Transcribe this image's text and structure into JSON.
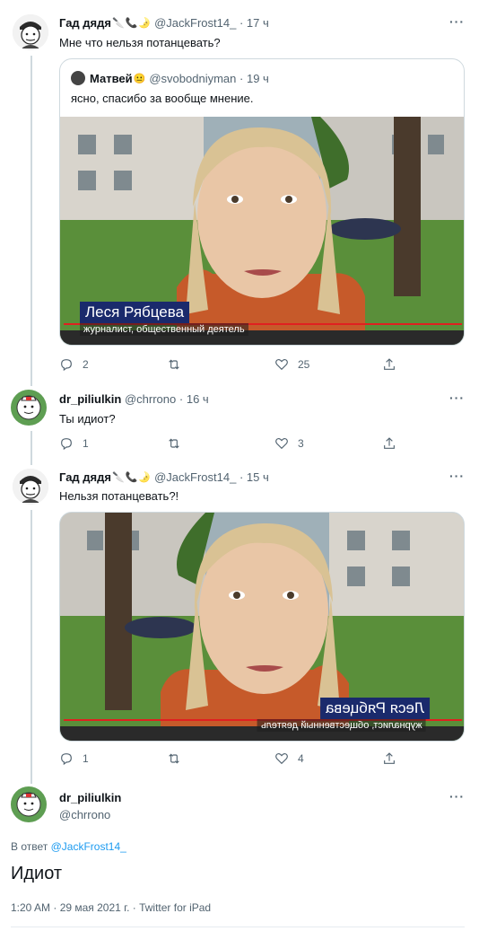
{
  "tweets": [
    {
      "name": "Гад дядя",
      "handle": "@JackFrost14_",
      "dot": "·",
      "time": "17 ч",
      "text": "Мне что нельзя потанцевать?",
      "quote": {
        "name": "Матвей",
        "handle": "@svobodniyman",
        "dot": "·",
        "time": "19 ч",
        "text": "ясно, спасибо за вообще мнение.",
        "video_caption": "Леся Рябцева",
        "video_sub": "журналист, общественный деятель"
      },
      "replies": "2",
      "retweets": "",
      "likes": "25"
    },
    {
      "name": "dr_piliulkin",
      "handle": "@chrrono",
      "dot": "·",
      "time": "16 ч",
      "text": "Ты идиот?",
      "replies": "1",
      "retweets": "",
      "likes": "3"
    },
    {
      "name": "Гад дядя",
      "handle": "@JackFrost14_",
      "dot": "·",
      "time": "15 ч",
      "text": "Нельзя потанцевать?!",
      "video_caption": "Леся Рябцева",
      "video_sub": "журналист, общественный деятель",
      "replies": "1",
      "retweets": "",
      "likes": "4"
    }
  ],
  "main": {
    "name": "dr_piliulkin",
    "handle": "@chrrono",
    "reply_prefix": "В ответ",
    "reply_handle": "@JackFrost14_",
    "text": "Идиот",
    "meta": "1:20 AM · 29 мая 2021 г. · Twitter for iPad"
  },
  "more_label": "···",
  "icons": {
    "reply": "reply-icon",
    "retweet": "retweet-icon",
    "like": "heart-icon",
    "share": "share-icon"
  },
  "colors": {
    "link": "#1d9bf0",
    "secondary": "#536471",
    "border": "#cfd9de",
    "caption_bg": "#1a2a6c"
  }
}
